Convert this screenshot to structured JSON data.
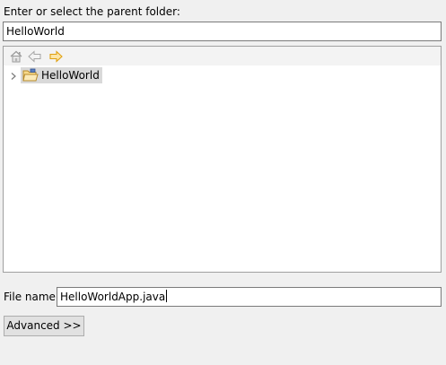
{
  "parent_folder": {
    "label": "Enter or select the parent folder:",
    "value": "HelloWorld"
  },
  "toolbar": {
    "icons": [
      "home-icon",
      "back-arrow-icon",
      "forward-arrow-icon"
    ]
  },
  "tree": {
    "nodes": [
      {
        "label": "HelloWorld",
        "icon": "project-folder-icon",
        "expanded": false,
        "selected": true
      }
    ]
  },
  "file_name": {
    "label": "File name:",
    "value": "HelloWorldApp.java"
  },
  "advanced_button": {
    "label": "Advanced >>"
  },
  "colors": {
    "background": "#f0f0f0",
    "selection": "#d9d9d9",
    "forward_arrow": "#e8a317"
  }
}
